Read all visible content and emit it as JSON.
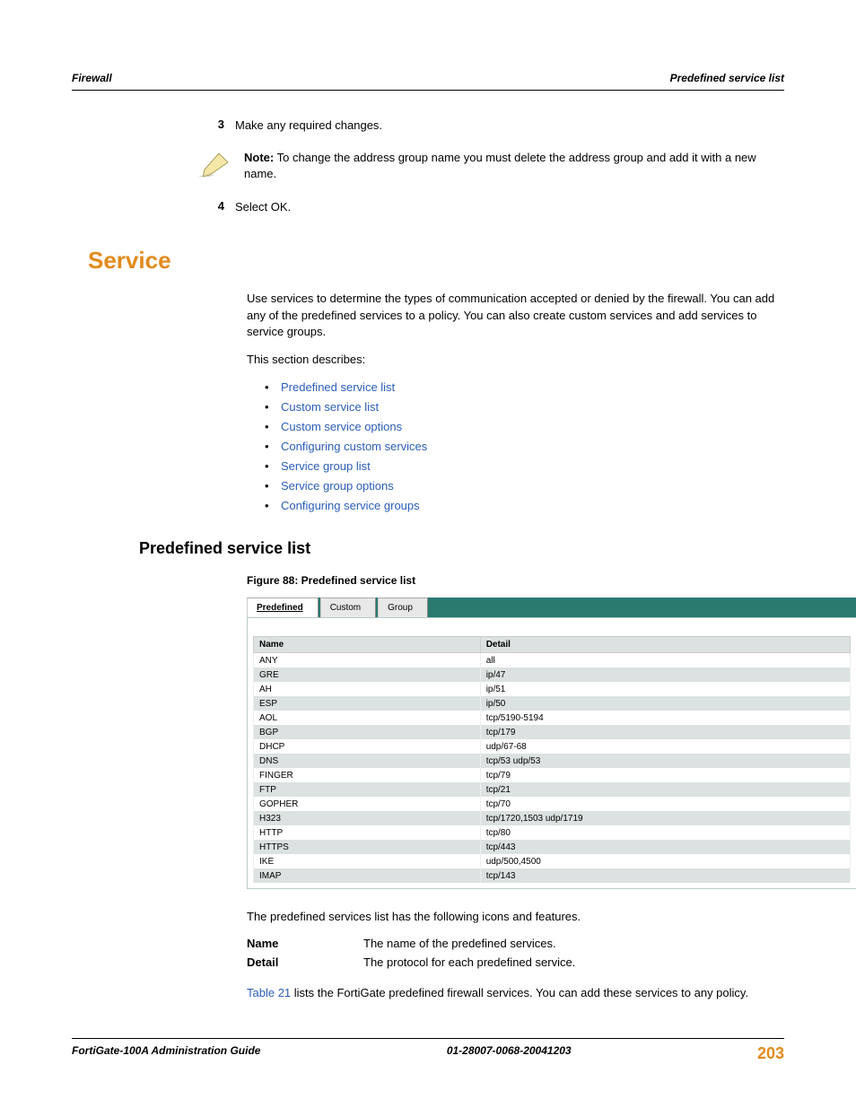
{
  "header": {
    "left": "Firewall",
    "right": "Predefined service list"
  },
  "steps": [
    {
      "num": "3",
      "text": "Make any required changes."
    },
    {
      "num": "4",
      "text": "Select OK."
    }
  ],
  "note": {
    "boldLabel": "Note:",
    "text": " To change the address group name you must delete the address group and add it with a new name."
  },
  "service": {
    "heading": "Service",
    "para1": "Use services to determine the types of communication accepted or denied by the firewall. You can add any of the predefined services to a policy. You can also create custom services and add services to service groups.",
    "para2": "This section describes:",
    "links": [
      "Predefined service list",
      "Custom service list",
      "Custom service options",
      "Configuring custom services",
      "Service group list",
      "Service group options",
      "Configuring service groups"
    ]
  },
  "subsection": {
    "heading": "Predefined service list",
    "figureCaption": "Figure 88: Predefined service list"
  },
  "tabs": {
    "active": "Predefined",
    "b": "Custom",
    "c": "Group"
  },
  "tableHeaders": {
    "name": "Name",
    "detail": "Detail"
  },
  "tableRows": [
    {
      "name": "ANY",
      "detail": "all"
    },
    {
      "name": "GRE",
      "detail": "ip/47"
    },
    {
      "name": "AH",
      "detail": "ip/51"
    },
    {
      "name": "ESP",
      "detail": "ip/50"
    },
    {
      "name": "AOL",
      "detail": "tcp/5190-5194"
    },
    {
      "name": "BGP",
      "detail": "tcp/179"
    },
    {
      "name": "DHCP",
      "detail": "udp/67-68"
    },
    {
      "name": "DNS",
      "detail": "tcp/53 udp/53"
    },
    {
      "name": "FINGER",
      "detail": "tcp/79"
    },
    {
      "name": "FTP",
      "detail": "tcp/21"
    },
    {
      "name": "GOPHER",
      "detail": "tcp/70"
    },
    {
      "name": "H323",
      "detail": "tcp/1720,1503 udp/1719"
    },
    {
      "name": "HTTP",
      "detail": "tcp/80"
    },
    {
      "name": "HTTPS",
      "detail": "tcp/443"
    },
    {
      "name": "IKE",
      "detail": "udp/500,4500"
    },
    {
      "name": "IMAP",
      "detail": "tcp/143"
    }
  ],
  "afterFigure": {
    "intro": "The predefined services list has the following icons and features.",
    "rows": [
      {
        "label": "Name",
        "value": "The name of the predefined services."
      },
      {
        "label": "Detail",
        "value": "The protocol for each predefined service."
      }
    ],
    "tableRefLink": "Table 21",
    "tableRefText": " lists the FortiGate predefined firewall services. You can add these services to any policy."
  },
  "footer": {
    "left": "FortiGate-100A Administration Guide",
    "mid": "01-28007-0068-20041203",
    "right": "203"
  }
}
